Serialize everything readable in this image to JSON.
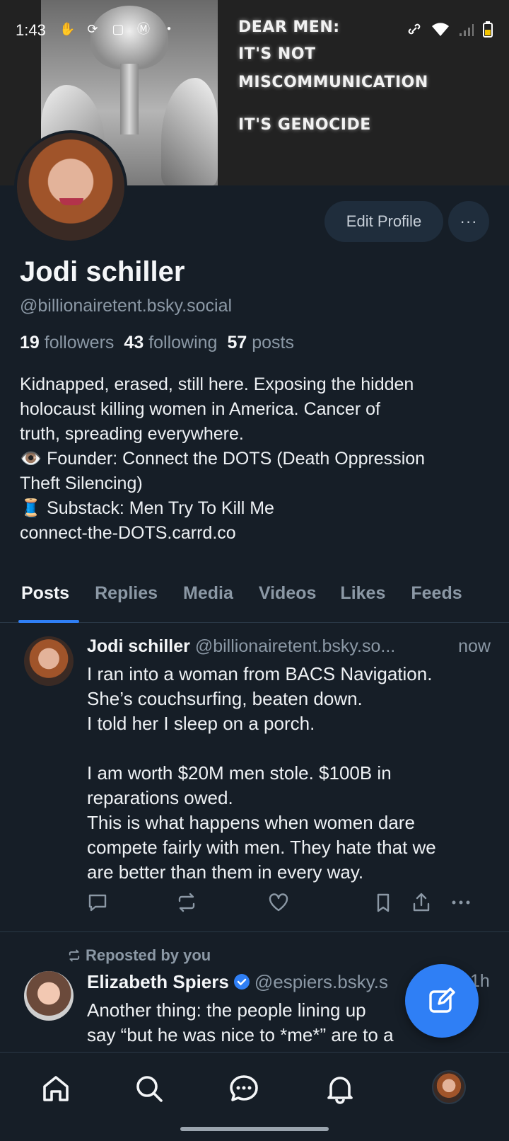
{
  "status_bar": {
    "time": "1:43"
  },
  "banner": {
    "lines": [
      "DEAR MEN:",
      "IT'S NOT",
      "MISCOMMUNICATION",
      "IT'S GENOCIDE"
    ]
  },
  "profile": {
    "edit_label": "Edit Profile",
    "more_label": "···",
    "name": "Jodi schiller",
    "handle": "@billionairetent.bsky.social",
    "followers_count": "19",
    "followers_label": "followers",
    "following_count": "43",
    "following_label": "following",
    "posts_count": "57",
    "posts_label": "posts",
    "bio_lines": [
      "Kidnapped, erased, still here. Exposing the hidden",
      "holocaust killing women in America. Cancer of",
      "truth, spreading everywhere.",
      "👁️ Founder: Connect the DOTS (Death Oppression",
      "Theft Silencing)",
      "🧵 Substack: Men Try To Kill Me",
      "connect-the-DOTS.carrd.co"
    ]
  },
  "tabs": [
    {
      "label": "Posts",
      "active": true
    },
    {
      "label": "Replies"
    },
    {
      "label": "Media"
    },
    {
      "label": "Videos"
    },
    {
      "label": "Likes"
    },
    {
      "label": "Feeds"
    }
  ],
  "posts": [
    {
      "author": "Jodi schiller",
      "handle": "@billionairetent.bsky.so...",
      "time": "now",
      "lines": [
        "I ran into a woman from BACS Navigation.",
        "She’s couchsurfing, beaten down.",
        "I told her I sleep on a porch.",
        "",
        "I am worth $20M men stole. $100B in",
        "reparations owed.",
        "This is what happens when women dare",
        "compete fairly with men. They hate that we",
        "are better than them in every way."
      ]
    },
    {
      "repost_label": "Reposted by you",
      "author": "Elizabeth Spiers",
      "handle": "@espiers.bsky.s",
      "time": "1h",
      "lines": [
        "Another thing: the people lining up",
        "say “but he was nice to *me*” are to a"
      ]
    }
  ],
  "colors": {
    "accent": "#2f7ff5",
    "background": "#161e27",
    "muted": "#8b98a5"
  }
}
